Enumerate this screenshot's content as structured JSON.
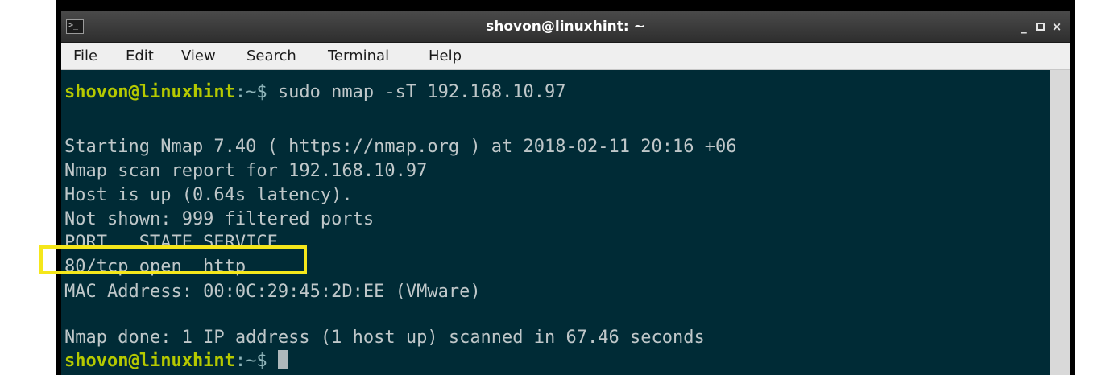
{
  "window": {
    "title": "shovon@linuxhint: ~",
    "terminal_icon": "terminal-icon",
    "minimize_label": "_",
    "close_label": "×"
  },
  "menu": {
    "items": [
      "File",
      "Edit",
      "View",
      "Search",
      "Terminal",
      "Help"
    ]
  },
  "terminal": {
    "prompt_user": "shovon@linuxhint",
    "prompt_path": ":~$",
    "command": " sudo nmap -sT 192.168.10.97",
    "lines": [
      "Starting Nmap 7.40 ( https://nmap.org ) at 2018-02-11 20:16 +06",
      "Nmap scan report for 192.168.10.97",
      "Host is up (0.64s latency).",
      "Not shown: 999 filtered ports",
      "PORT   STATE SERVICE",
      "80/tcp open  http",
      "MAC Address: 00:0C:29:45:2D:EE (VMware)",
      "Nmap done: 1 IP address (1 host up) scanned in 67.46 seconds"
    ]
  },
  "colors": {
    "terminal_bg": "#002b36",
    "prompt_user": "#b5c900",
    "highlight_box": "#f5e71b"
  }
}
